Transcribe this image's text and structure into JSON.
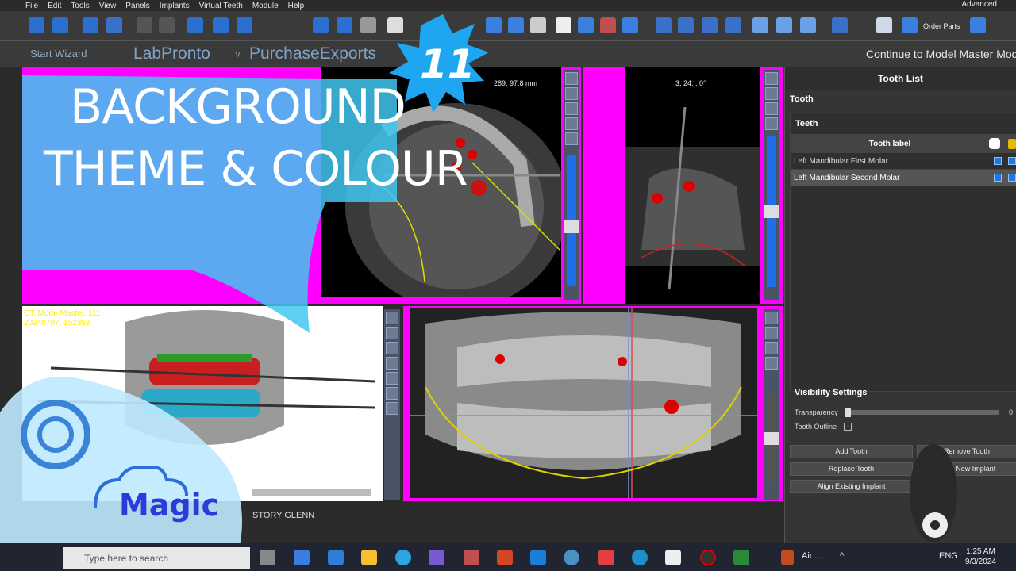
{
  "menu": [
    "File",
    "Edit",
    "Tools",
    "View",
    "Panels",
    "Implants",
    "Virtual Teeth",
    "Module",
    "Help"
  ],
  "mode_label": "Advanced",
  "toolbar": {
    "order_parts": "Order Parts"
  },
  "bar2": {
    "start_wizard": "Start Wizard",
    "labpronto": "LabPronto",
    "dropdown_caret": "˅",
    "purchase_exports": "PurchaseExports",
    "continue_label": "Continue to Model Master Module"
  },
  "overlay": {
    "episode_number": "11",
    "title_line1": "BACKGROUND",
    "title_line2": "THEME & COLOUR",
    "brand": "Magic"
  },
  "axial_view": {
    "coords": "289, 97.8 mm"
  },
  "sagittal_view": {
    "coords": "3, 24, , 0°"
  },
  "three_d_view": {
    "case_lines": [
      "CT, Mode Master, 111",
      "20240707, 152352"
    ]
  },
  "panel": {
    "title": "Tooth List",
    "tooth_section": "Tooth",
    "teeth_section": "Teeth",
    "col_label": "Tooth label",
    "rows": [
      {
        "label": "Left Mandibular First Molar",
        "selected": false
      },
      {
        "label": "Left Mandibular Second Molar",
        "selected": true
      }
    ],
    "visibility_title": "Visibility Settings",
    "transparency_label": "Transparency",
    "transparency_value": 0,
    "transparency_shown": "0",
    "outline_label": "Tooth Outline",
    "outline_checked": false,
    "buttons": {
      "add_tooth": "Add Tooth",
      "remove_tooth": "Remove Tooth",
      "replace_tooth": "Replace Tooth",
      "align_new": "Align New Implant",
      "align_existing": "Align Existing Implant"
    }
  },
  "bottom_link": "STORY GLENN",
  "taskbar": {
    "search_placeholder": "Type here to search",
    "air_label": "Air:...",
    "lang": "ENG",
    "time": "1:25 AM",
    "date": "9/3/2024"
  },
  "colors": {
    "magenta": "#ff00ff",
    "accent": "#1f7ae0"
  }
}
